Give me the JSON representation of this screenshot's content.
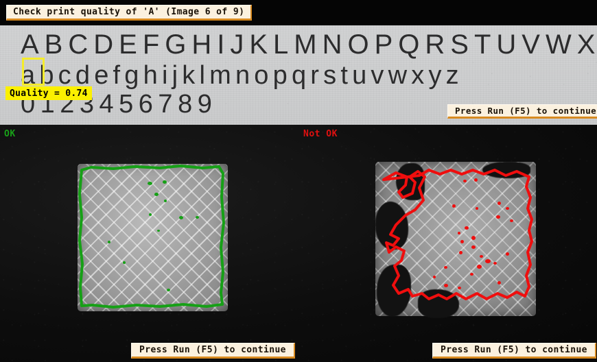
{
  "window": {
    "title_chip": "Check print quality of 'A' (Image  6 of 9)"
  },
  "print_quality_panel": {
    "rows": {
      "uppercase": "ABCDEFGHIJKLMNOPQRSTUVWXYZ",
      "lowercase": "abcdefghijklmnopqrstuvwxyz",
      "digits": "0123456789"
    },
    "highlighted_character": "A",
    "quality_label": "Quality = 0.74",
    "quality_value": 0.74,
    "continue_button": "Press Run (F5) to continue",
    "highlight_color": "#f5ec2a",
    "quality_chip_color": "#fbf000"
  },
  "inspection_panel": {
    "left": {
      "verdict": "OK",
      "verdict_color": "#18a018",
      "contour_color": "#16a016",
      "continue_button": "Press Run (F5) to continue"
    },
    "right": {
      "verdict": "Not OK",
      "verdict_color": "#e01010",
      "contour_color": "#ef0e0e",
      "continue_button": "Press Run (F5) to continue"
    }
  },
  "theme": {
    "chip_background": "#fbf1df",
    "chip_border": "#d88a20",
    "paper_background": "#cdcecf",
    "dark_background": "#0a0a0a"
  }
}
